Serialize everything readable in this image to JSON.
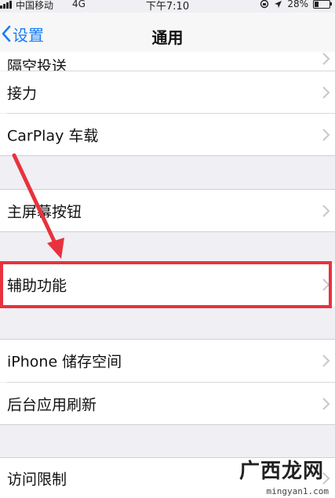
{
  "status_bar": {
    "carrier": "中国移动",
    "network": "4G",
    "time": "下午7:10",
    "battery_percent": "28%",
    "battery_level": 0.28
  },
  "nav": {
    "back_label": "设置",
    "title": "通用"
  },
  "rows": [
    {
      "label": "隔空投送"
    },
    {
      "label": "接力"
    },
    {
      "label": "CarPlay 车载"
    },
    {
      "label": "主屏幕按钮"
    },
    {
      "label": "辅助功能"
    },
    {
      "label": "iPhone 储存空间"
    },
    {
      "label": "后台应用刷新"
    },
    {
      "label": "访问限制"
    }
  ],
  "annotation": {
    "highlight_color": "#e8323d"
  },
  "watermark": {
    "logo": "广西龙网",
    "url": "mingyan1.com"
  },
  "colors": {
    "accent": "#1a7cf6",
    "background": "#efeff4"
  }
}
